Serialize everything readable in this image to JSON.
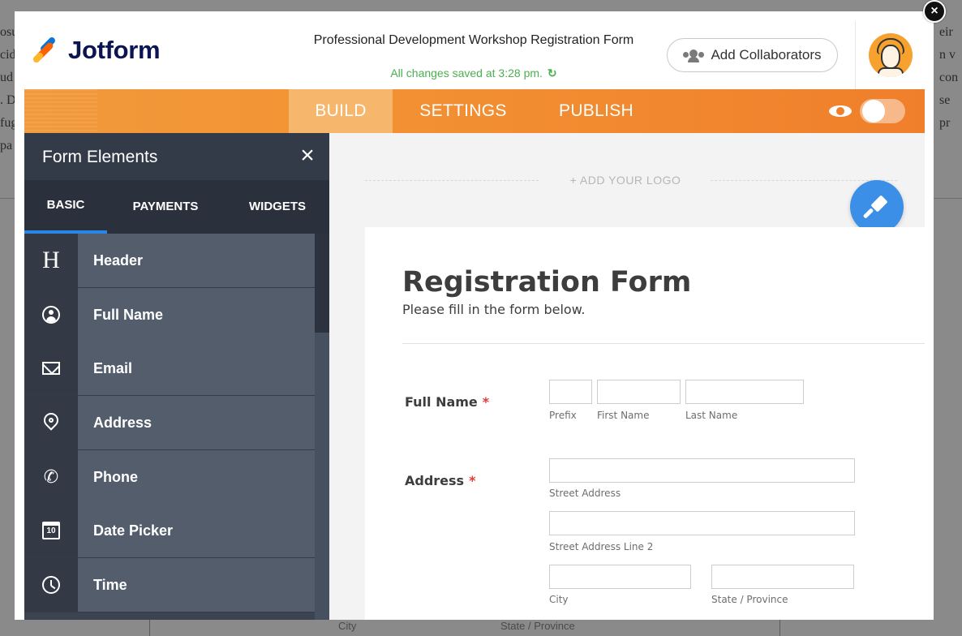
{
  "app": {
    "brand": "Jotform",
    "form_title": "Professional Development Workshop Registration Form",
    "saved_status": "All changes saved at 3:28 pm.",
    "undo_icon": "refresh-icon",
    "collaborators_label": "Add Collaborators",
    "close_label": "×"
  },
  "nav": {
    "build": "BUILD",
    "settings": "SETTINGS",
    "publish": "PUBLISH",
    "active": "BUILD",
    "preview_toggle_on": false
  },
  "sidebar": {
    "title": "Form Elements",
    "close_label": "×",
    "tabs": [
      {
        "label": "BASIC",
        "active": true
      },
      {
        "label": "PAYMENTS",
        "active": false
      },
      {
        "label": "WIDGETS",
        "active": false
      }
    ],
    "items": [
      {
        "label": "Header",
        "icon": "header-icon",
        "glyph": "H"
      },
      {
        "label": "Full Name",
        "icon": "person-icon"
      },
      {
        "label": "Email",
        "icon": "envelope-icon"
      },
      {
        "label": "Address",
        "icon": "location-pin-icon"
      },
      {
        "label": "Phone",
        "icon": "phone-icon",
        "glyph": "✆"
      },
      {
        "label": "Date Picker",
        "icon": "calendar-icon",
        "glyph": "10"
      },
      {
        "label": "Time",
        "icon": "clock-icon"
      }
    ]
  },
  "canvas": {
    "add_logo": "+ ADD YOUR LOGO",
    "designer_icon": "paint-roller-icon"
  },
  "form": {
    "title": "Registration Form",
    "subtitle": "Please fill in the form below.",
    "fields": {
      "full_name": {
        "label": "Full Name",
        "required_mark": "*",
        "sublabels": {
          "prefix": "Prefix",
          "first": "First Name",
          "last": "Last Name"
        }
      },
      "address": {
        "label": "Address",
        "required_mark": "*",
        "sublabels": {
          "street": "Street Address",
          "street2": "Street Address Line 2",
          "city": "City",
          "state": "State / Province"
        }
      }
    }
  },
  "background_page": {
    "left_fragments": [
      "osu",
      "cid",
      "ud",
      ". D",
      "fug",
      "pa"
    ],
    "right_fragments": [
      "eir",
      "n v",
      "con",
      "se",
      "pr"
    ],
    "bottom_labels": {
      "city": "City",
      "state": "State / Province"
    }
  },
  "colors": {
    "nav_orange": "#f07f2b",
    "nav_active": "#f6b66b",
    "sidebar_bg": "#3b4351",
    "tab_indicator": "#2b85e6",
    "saved_green": "#4caf50",
    "required_red": "#e53935",
    "designer_blue": "#3c8fe6"
  }
}
